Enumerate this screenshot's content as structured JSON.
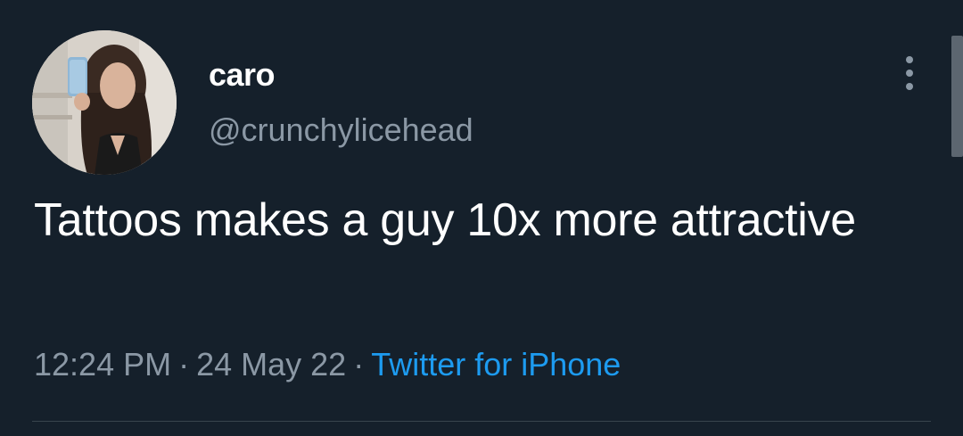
{
  "author": {
    "display_name": "caro",
    "handle": "@crunchylicehead",
    "avatar": "profile-photo"
  },
  "tweet": {
    "text": "Tattoos makes a guy 10x more attractive"
  },
  "meta": {
    "time": "12:24 PM",
    "separator": "·",
    "date": "24 May 22",
    "source": "Twitter for iPhone"
  },
  "colors": {
    "background": "#15202b",
    "primary_text": "#ffffff",
    "secondary_text": "#8b98a5",
    "accent": "#1d9bf0",
    "divider": "#38444d"
  },
  "icons": {
    "more": "more-vertical-icon"
  }
}
